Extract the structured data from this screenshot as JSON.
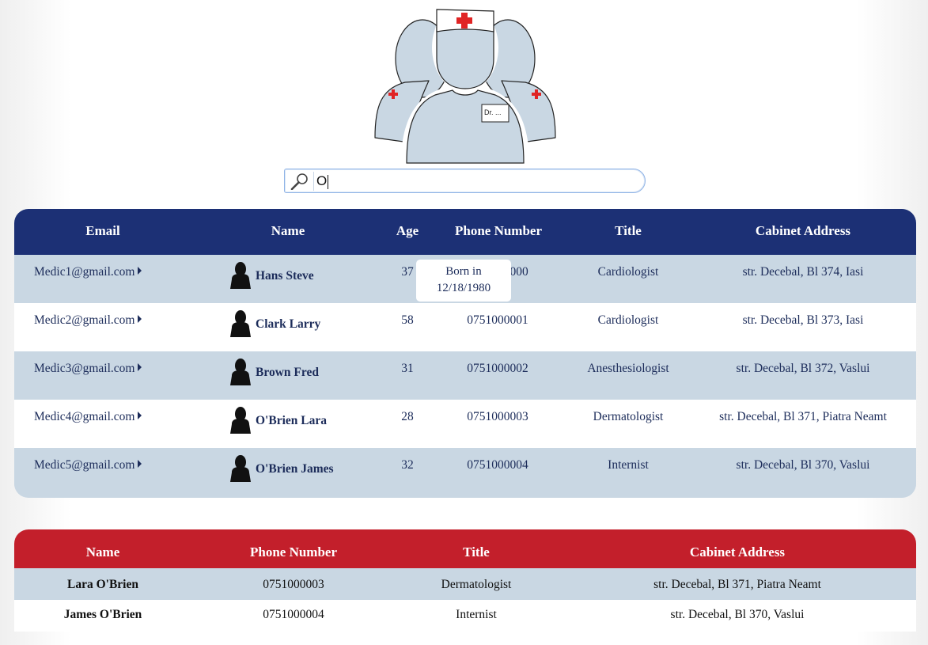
{
  "search": {
    "value": "O",
    "placeholder": ""
  },
  "doctors_table": {
    "headers": [
      "Email",
      "Name",
      "Age",
      "Phone Number",
      "Title",
      "Cabinet Address"
    ],
    "rows": [
      {
        "email": "Medic1@gmail.com",
        "name": "Hans Steve",
        "age": "37",
        "phone": "0751000000",
        "title": "Cardiologist",
        "address": "str. Decebal, Bl 374, Iasi"
      },
      {
        "email": "Medic2@gmail.com",
        "name": "Clark Larry",
        "age": "58",
        "phone": "0751000001",
        "title": "Cardiologist",
        "address": "str. Decebal, Bl 373, Iasi"
      },
      {
        "email": "Medic3@gmail.com",
        "name": "Brown Fred",
        "age": "31",
        "phone": "0751000002",
        "title": "Anesthesiologist",
        "address": "str. Decebal, Bl 372, Vaslui"
      },
      {
        "email": "Medic4@gmail.com",
        "name": "O'Brien Lara",
        "age": "28",
        "phone": "0751000003",
        "title": "Dermatologist",
        "address": "str. Decebal, Bl 371, Piatra Neamt"
      },
      {
        "email": "Medic5@gmail.com",
        "name": "O'Brien James",
        "age": "32",
        "phone": "0751000004",
        "title": "Internist",
        "address": "str. Decebal, Bl 370, Vaslui"
      }
    ]
  },
  "tooltip": {
    "line1": "Born in",
    "line2": "12/18/1980"
  },
  "results_table": {
    "headers": [
      "Name",
      "Phone Number",
      "Title",
      "Cabinet Address"
    ],
    "rows": [
      {
        "name": "Lara O'Brien",
        "phone": "0751000003",
        "title": "Dermatologist",
        "address": "str. Decebal, Bl 371, Piatra Neamt"
      },
      {
        "name": "James O'Brien",
        "phone": "0751000004",
        "title": "Internist",
        "address": "str. Decebal, Bl 370, Vaslui"
      }
    ]
  },
  "logo": {
    "badge_text": "Dr. ..."
  },
  "colors": {
    "doctors_header": "#1c3075",
    "results_header": "#c31f2b",
    "row_shade": "#c9d7e3",
    "cross": "#e02424"
  },
  "icons": [
    "doctors-logo-icon",
    "magnifier-icon",
    "person-silhouette-icon",
    "caret-right-icon"
  ]
}
